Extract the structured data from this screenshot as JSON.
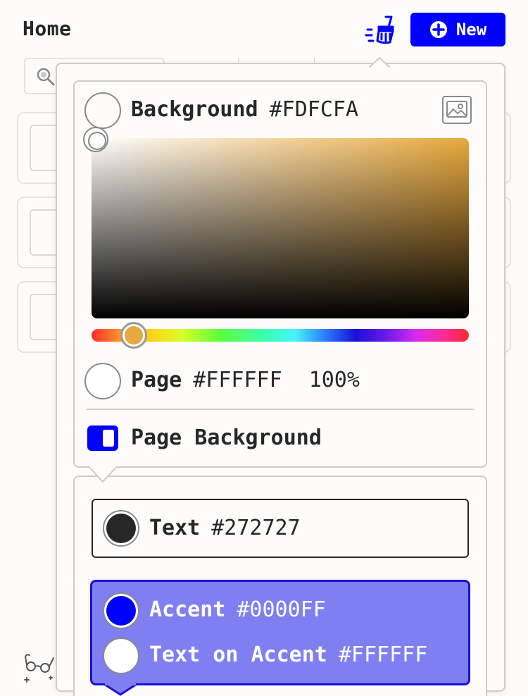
{
  "header": {
    "title": "Home",
    "new_button_label": "New"
  },
  "icons": {
    "brush": "paint-brush-icon",
    "plus": "plus-circle-icon",
    "search": "search-icon",
    "image": "image-icon",
    "glasses": "glasses-icon"
  },
  "background": {
    "label": "Background",
    "hex": "#FDFCFA",
    "picked_hue_color": "#E8A93C"
  },
  "page": {
    "label": "Page",
    "hex": "#FFFFFF",
    "opacity": "100%"
  },
  "page_background_toggle": {
    "label": "Page Background",
    "enabled": true
  },
  "text_color": {
    "label": "Text",
    "hex": "#272727"
  },
  "accent_color": {
    "label": "Accent",
    "hex": "#0000FF"
  },
  "text_on_accent": {
    "label": "Text on Accent",
    "hex": "#FFFFFF"
  },
  "colors": {
    "brand_blue": "#0000FF",
    "accent_panel": "#7F7FF2",
    "surface": "#FDFCFA",
    "text": "#272727"
  }
}
